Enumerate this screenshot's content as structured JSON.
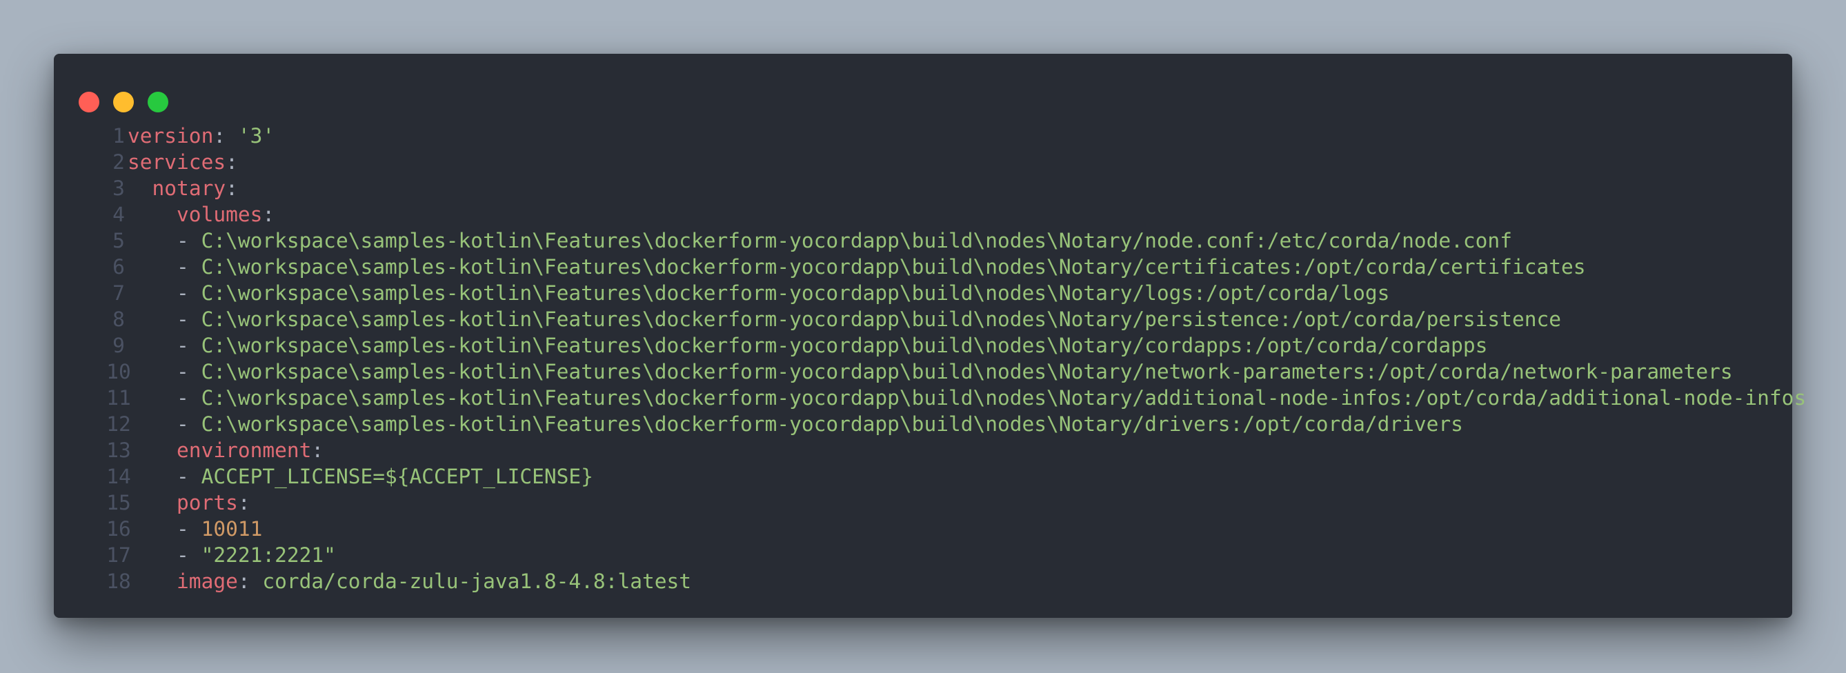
{
  "window": {
    "controls": [
      {
        "name": "close",
        "color": "#ff5f56"
      },
      {
        "name": "minimize",
        "color": "#ffbd2e"
      },
      {
        "name": "maximize",
        "color": "#27c93f"
      }
    ]
  },
  "code": {
    "language": "yaml",
    "lines": [
      {
        "n": "1",
        "tokens": [
          {
            "t": "version",
            "c": "k"
          },
          {
            "t": ": ",
            "c": "p"
          },
          {
            "t": "'3'",
            "c": "s"
          }
        ]
      },
      {
        "n": "2",
        "tokens": [
          {
            "t": "services",
            "c": "k"
          },
          {
            "t": ":",
            "c": "p"
          }
        ]
      },
      {
        "n": "3",
        "tokens": [
          {
            "t": "  ",
            "c": "p"
          },
          {
            "t": "notary",
            "c": "k"
          },
          {
            "t": ":",
            "c": "p"
          }
        ]
      },
      {
        "n": "4",
        "tokens": [
          {
            "t": "    ",
            "c": "p"
          },
          {
            "t": "volumes",
            "c": "k"
          },
          {
            "t": ":",
            "c": "p"
          }
        ]
      },
      {
        "n": "5",
        "tokens": [
          {
            "t": "    - ",
            "c": "p"
          },
          {
            "t": "C:\\workspace\\samples-kotlin\\Features\\dockerform-yocordapp\\build\\nodes\\Notary/node.conf:/etc/corda/node.conf",
            "c": "s"
          }
        ]
      },
      {
        "n": "6",
        "tokens": [
          {
            "t": "    - ",
            "c": "p"
          },
          {
            "t": "C:\\workspace\\samples-kotlin\\Features\\dockerform-yocordapp\\build\\nodes\\Notary/certificates:/opt/corda/certificates",
            "c": "s"
          }
        ]
      },
      {
        "n": "7",
        "tokens": [
          {
            "t": "    - ",
            "c": "p"
          },
          {
            "t": "C:\\workspace\\samples-kotlin\\Features\\dockerform-yocordapp\\build\\nodes\\Notary/logs:/opt/corda/logs",
            "c": "s"
          }
        ]
      },
      {
        "n": "8",
        "tokens": [
          {
            "t": "    - ",
            "c": "p"
          },
          {
            "t": "C:\\workspace\\samples-kotlin\\Features\\dockerform-yocordapp\\build\\nodes\\Notary/persistence:/opt/corda/persistence",
            "c": "s"
          }
        ]
      },
      {
        "n": "9",
        "tokens": [
          {
            "t": "    - ",
            "c": "p"
          },
          {
            "t": "C:\\workspace\\samples-kotlin\\Features\\dockerform-yocordapp\\build\\nodes\\Notary/cordapps:/opt/corda/cordapps",
            "c": "s"
          }
        ]
      },
      {
        "n": "10",
        "tokens": [
          {
            "t": "    - ",
            "c": "p"
          },
          {
            "t": "C:\\workspace\\samples-kotlin\\Features\\dockerform-yocordapp\\build\\nodes\\Notary/network-parameters:/opt/corda/network-parameters",
            "c": "s"
          }
        ]
      },
      {
        "n": "11",
        "tokens": [
          {
            "t": "    - ",
            "c": "p"
          },
          {
            "t": "C:\\workspace\\samples-kotlin\\Features\\dockerform-yocordapp\\build\\nodes\\Notary/additional-node-infos:/opt/corda/additional-node-infos",
            "c": "s"
          }
        ]
      },
      {
        "n": "12",
        "tokens": [
          {
            "t": "    - ",
            "c": "p"
          },
          {
            "t": "C:\\workspace\\samples-kotlin\\Features\\dockerform-yocordapp\\build\\nodes\\Notary/drivers:/opt/corda/drivers",
            "c": "s"
          }
        ]
      },
      {
        "n": "13",
        "tokens": [
          {
            "t": "    ",
            "c": "p"
          },
          {
            "t": "environment",
            "c": "k"
          },
          {
            "t": ":",
            "c": "p"
          }
        ]
      },
      {
        "n": "14",
        "tokens": [
          {
            "t": "    - ",
            "c": "p"
          },
          {
            "t": "ACCEPT_LICENSE=${ACCEPT_LICENSE}",
            "c": "s"
          }
        ]
      },
      {
        "n": "15",
        "tokens": [
          {
            "t": "    ",
            "c": "p"
          },
          {
            "t": "ports",
            "c": "k"
          },
          {
            "t": ":",
            "c": "p"
          }
        ]
      },
      {
        "n": "16",
        "tokens": [
          {
            "t": "    - ",
            "c": "p"
          },
          {
            "t": "10011",
            "c": "n"
          }
        ]
      },
      {
        "n": "17",
        "tokens": [
          {
            "t": "    - ",
            "c": "p"
          },
          {
            "t": "\"2221:2221\"",
            "c": "s"
          }
        ]
      },
      {
        "n": "18",
        "tokens": [
          {
            "t": "    ",
            "c": "p"
          },
          {
            "t": "image",
            "c": "k"
          },
          {
            "t": ": ",
            "c": "p"
          },
          {
            "t": "corda/corda-zulu-java1.8-4.8:latest",
            "c": "s"
          }
        ]
      }
    ]
  }
}
